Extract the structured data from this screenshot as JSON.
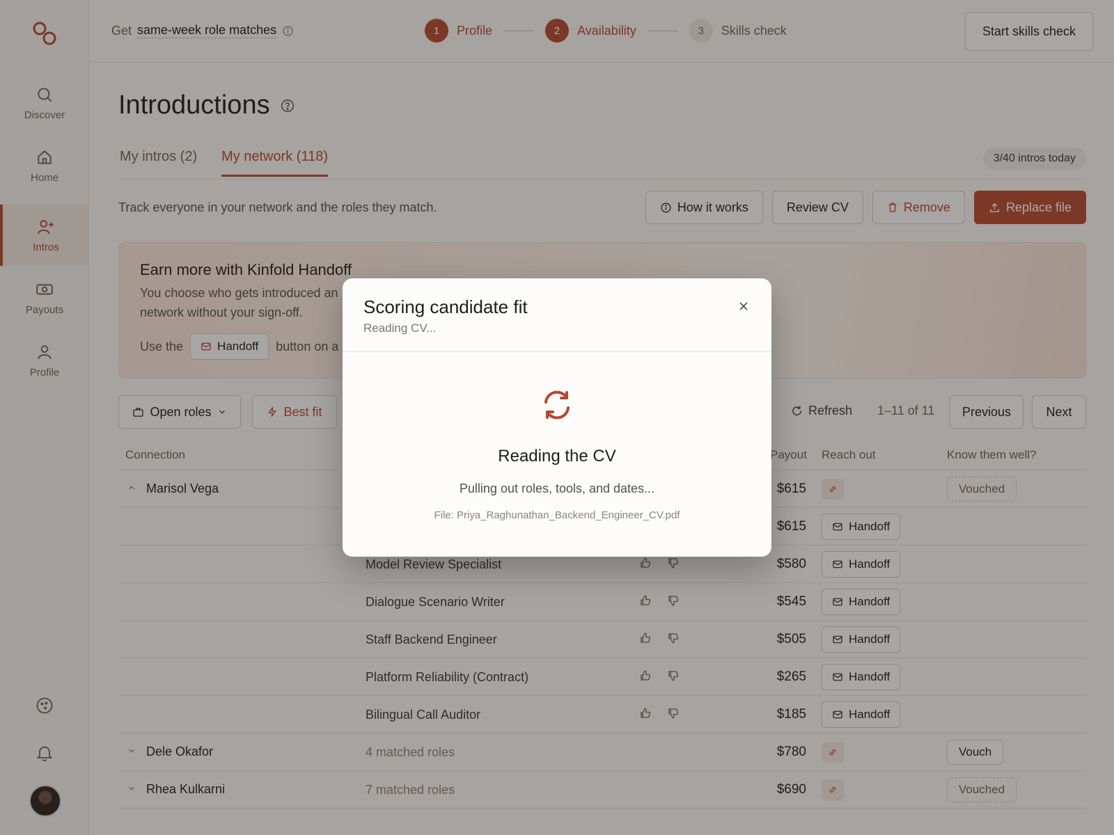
{
  "topbar": {
    "promo_prefix": "Get",
    "promo_link": "same-week role matches",
    "steps": [
      {
        "num": "1",
        "label": "Profile"
      },
      {
        "num": "2",
        "label": "Availability"
      },
      {
        "num": "3",
        "label": "Skills check"
      }
    ],
    "start_button": "Start skills check"
  },
  "sidebar": {
    "items": [
      {
        "label": "Discover",
        "icon": "search-icon"
      },
      {
        "label": "Home",
        "icon": "home-icon"
      },
      {
        "label": "Intros",
        "icon": "user-plus-icon"
      },
      {
        "label": "Payouts",
        "icon": "money-icon"
      },
      {
        "label": "Profile",
        "icon": "user-icon"
      }
    ]
  },
  "page": {
    "title": "Introductions",
    "tabs": [
      "My intros (2)",
      "My network (118)"
    ],
    "quota": "3/40 intros today",
    "description": "Track everyone in your network and the roles they match.",
    "actions": {
      "how": "How it works",
      "review": "Review CV",
      "remove": "Remove",
      "replace": "Replace file"
    }
  },
  "banner": {
    "title": "Earn more with Kinfold Handoff",
    "text": "You choose who gets introduced an",
    "text2": "network without your sign-off.",
    "use_prefix": "Use the",
    "handoff_label": "Handoff",
    "use_suffix": "button on a"
  },
  "filters": {
    "open_roles": "Open roles",
    "best_fit": "Best fit",
    "refresh": "Refresh",
    "range": "1–11 of 11",
    "previous": "Previous",
    "next": "Next"
  },
  "table": {
    "headers": {
      "connection": "Connection",
      "payout": "Payout",
      "reach": "Reach out",
      "know": "Know them well?"
    },
    "handoff_label": "Handoff",
    "rows": [
      {
        "person": "Marisol Vega",
        "role": "",
        "payout": "$615",
        "reach": "link",
        "know": "Vouched",
        "expanded": true
      },
      {
        "person": "",
        "role": "",
        "payout": "$615",
        "reach": "handoff",
        "know": ""
      },
      {
        "person": "",
        "role": "Model Review Specialist",
        "payout": "$580",
        "reach": "handoff",
        "know": ""
      },
      {
        "person": "",
        "role": "Dialogue Scenario Writer",
        "payout": "$545",
        "reach": "handoff",
        "know": ""
      },
      {
        "person": "",
        "role": "Staff Backend Engineer",
        "payout": "$505",
        "reach": "handoff",
        "know": ""
      },
      {
        "person": "",
        "role": "Platform Reliability (Contract)",
        "payout": "$265",
        "reach": "handoff",
        "know": ""
      },
      {
        "person": "",
        "role": "Bilingual Call Auditor",
        "payout": "$185",
        "reach": "handoff",
        "know": ""
      },
      {
        "person": "Dele Okafor",
        "role": "4 matched roles",
        "payout": "$780",
        "reach": "link",
        "know": "Vouch"
      },
      {
        "person": "Rhea Kulkarni",
        "role": "7 matched roles",
        "payout": "$690",
        "reach": "link",
        "know": "Vouched"
      }
    ]
  },
  "modal": {
    "title": "Scoring candidate fit",
    "subtitle": "Reading CV...",
    "heading": "Reading the CV",
    "text": "Pulling out roles, tools, and dates...",
    "file": "File: Priya_Raghunathan_Backend_Engineer_CV.pdf"
  },
  "colors": {
    "accent": "#b5472e",
    "background": "#f7f5f2",
    "overlay": "rgba(35,30,26,0.38)"
  }
}
